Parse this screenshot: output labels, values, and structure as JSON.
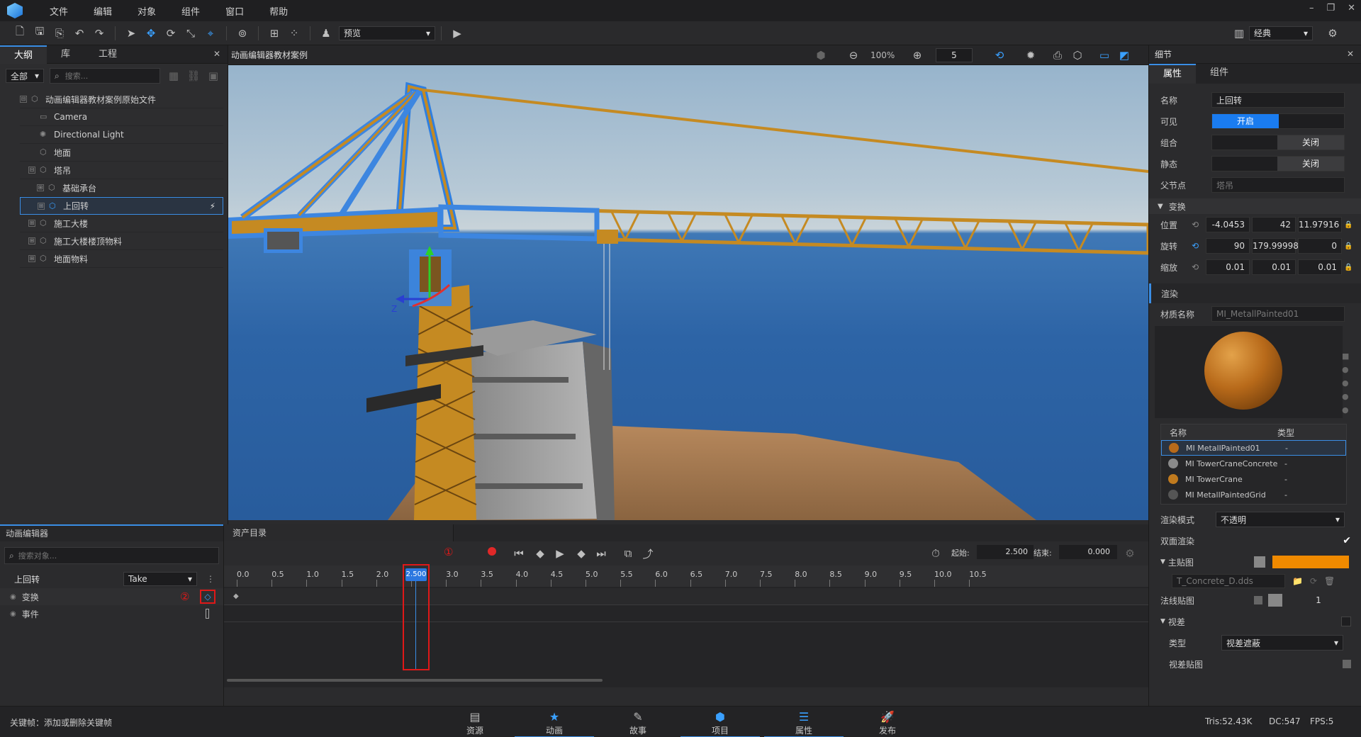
{
  "menu": {
    "items": [
      "文件",
      "编辑",
      "对象",
      "组件",
      "窗口",
      "帮助"
    ]
  },
  "toolbar": {
    "preview_label": "预览",
    "layout_label": "经典"
  },
  "outline": {
    "tabs": [
      "大纲",
      "库",
      "工程"
    ],
    "filter": "全部",
    "search_placeholder": "搜索...",
    "tree": [
      {
        "label": "动画编辑器教材案例原始文件",
        "depth": 0,
        "exp": "⊟"
      },
      {
        "label": "Camera",
        "depth": 1,
        "icon": "camera"
      },
      {
        "label": "Directional Light",
        "depth": 1,
        "icon": "light"
      },
      {
        "label": "地面",
        "depth": 1,
        "icon": "obj"
      },
      {
        "label": "塔吊",
        "depth": 1,
        "icon": "obj",
        "exp": "⊟"
      },
      {
        "label": "基础承台",
        "depth": 2,
        "icon": "obj",
        "exp": "⊞"
      },
      {
        "label": "上回转",
        "depth": 2,
        "icon": "obj",
        "exp": "⊞",
        "selected": true
      },
      {
        "label": "施工大楼",
        "depth": 1,
        "icon": "obj",
        "exp": "⊞"
      },
      {
        "label": "施工大楼楼顶物料",
        "depth": 1,
        "icon": "obj",
        "exp": "⊞"
      },
      {
        "label": "地面物料",
        "depth": 1,
        "icon": "obj",
        "exp": "⊞"
      }
    ]
  },
  "viewport": {
    "title": "动画编辑器教材案例",
    "zoom": "100%",
    "speed": "5",
    "axis_z": "Z"
  },
  "details": {
    "title": "细节",
    "tabs": [
      "属性",
      "组件"
    ],
    "name_label": "名称",
    "name_value": "上回转",
    "visible_label": "可见",
    "visible_value": "开启",
    "group_label": "组合",
    "group_value": "关闭",
    "static_label": "静态",
    "static_value": "关闭",
    "parent_label": "父节点",
    "parent_value": "塔吊",
    "transform_label": "变换",
    "pos_label": "位置",
    "pos": [
      "-4.0453",
      "42",
      "11.97916"
    ],
    "rot_label": "旋转",
    "rot": [
      "90",
      "179.99998",
      "0"
    ],
    "scale_label": "缩放",
    "scale": [
      "0.01",
      "0.01",
      "0.01"
    ],
    "render_label": "渲染",
    "material_label": "材质名称",
    "material_value": "MI_MetallPainted01",
    "mat_table_name": "名称",
    "mat_table_type": "类型",
    "materials": [
      {
        "name": "MI MetallPainted01",
        "type": "-",
        "color": "#b86a1a"
      },
      {
        "name": "MI TowerCraneConcrete",
        "type": "-",
        "color": "#8a8a8a"
      },
      {
        "name": "MI TowerCrane",
        "type": "-",
        "color": "#c07a1e"
      },
      {
        "name": "MI MetallPaintedGrid",
        "type": "-",
        "color": "#555555"
      }
    ],
    "render_mode_label": "渲染模式",
    "render_mode_value": "不透明",
    "double_side_label": "双面渲染",
    "main_tex_label": "主贴图",
    "main_tex_file": "T_Concrete_D.dds",
    "main_color": "#f08a00",
    "normal_tex_label": "法线贴图",
    "normal_value": "1",
    "parallax_label": "视差",
    "parallax_type_label": "类型",
    "parallax_type_value": "视差遮蔽",
    "parallax_tex_label": "视差贴图"
  },
  "anim": {
    "title": "动画编辑器",
    "search_placeholder": "搜索对象...",
    "track_name": "上回转",
    "take": "Take",
    "tracks": [
      "变换",
      "事件"
    ],
    "marker1": "①",
    "marker2": "②",
    "asset_title": "资产目录",
    "start_label": "起始:",
    "start_value": "2.500",
    "end_label": "结束:",
    "end_value": "0.000",
    "playhead": "2.500",
    "ticks": [
      "0.0",
      "0.5",
      "1.0",
      "1.5",
      "2.0",
      "2.5",
      "3.0",
      "3.5",
      "4.0",
      "4.5",
      "5.0",
      "5.5",
      "6.0",
      "6.5",
      "7.0",
      "7.5",
      "8.0",
      "8.5",
      "9.0",
      "9.5",
      "10.0",
      "10.5"
    ]
  },
  "status": {
    "hint": "关键帧：添加或删除关键帧",
    "tris": "Tris:52.43K",
    "dc": "DC:547",
    "fps": "FPS:5",
    "tabs": [
      "资源",
      "动画",
      "故事",
      "项目",
      "属性",
      "发布"
    ]
  }
}
